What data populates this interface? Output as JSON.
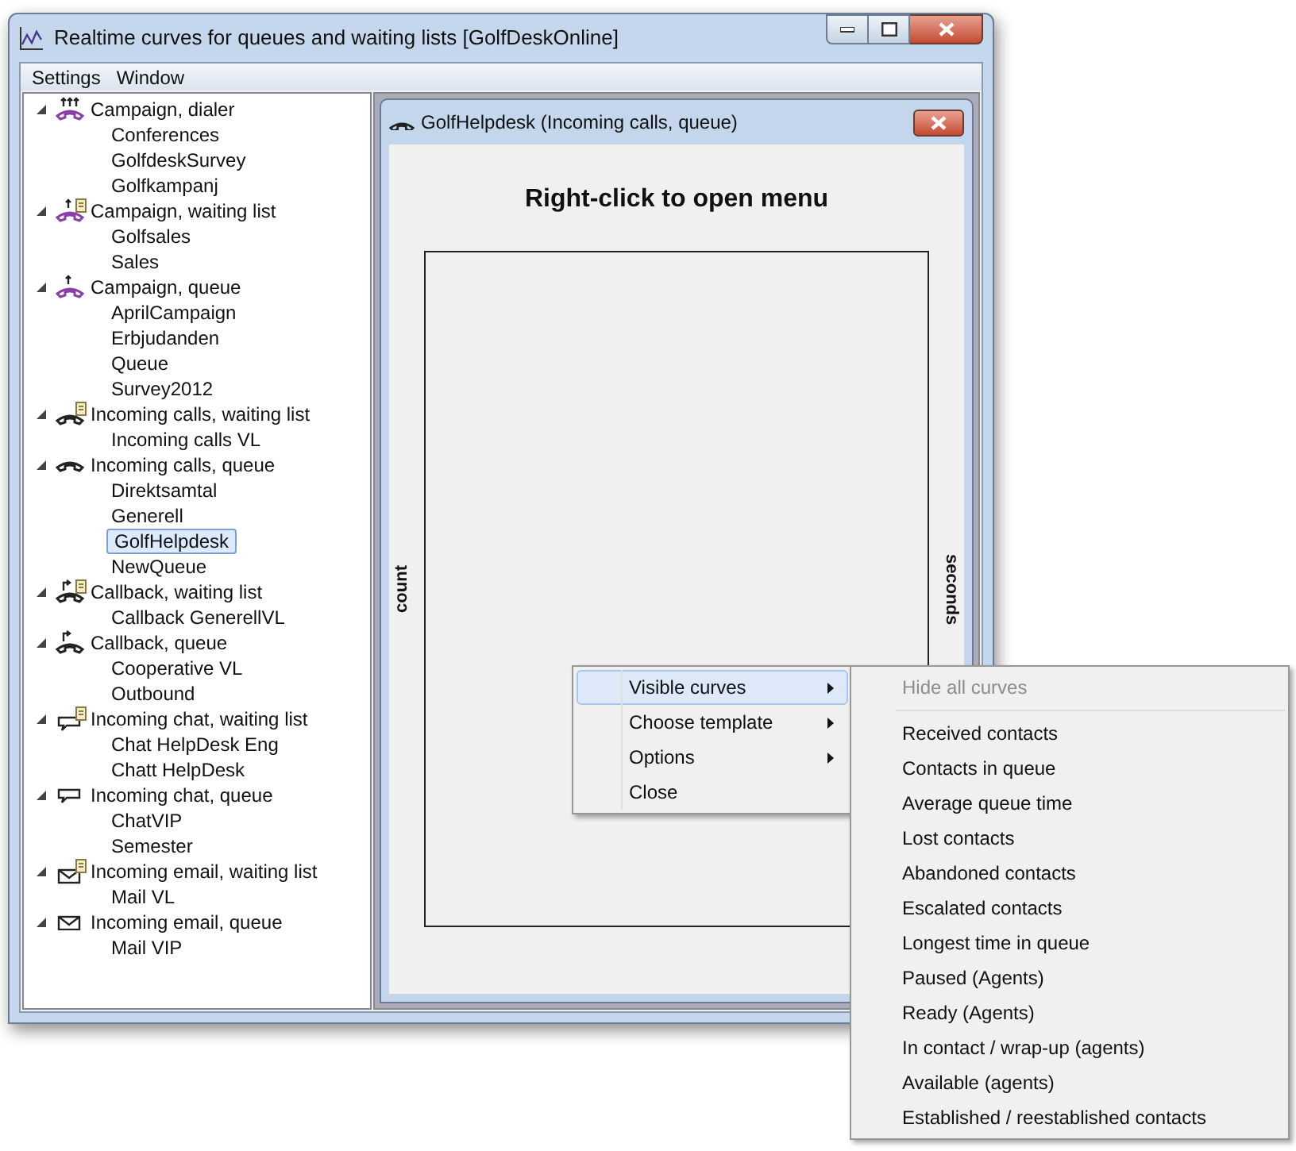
{
  "window": {
    "title": "Realtime curves for queues and waiting lists [GolfDeskOnline]"
  },
  "menu_bar": [
    "Settings",
    "Window"
  ],
  "tree": [
    {
      "label": "Campaign, dialer",
      "kind": "campaign-dialer",
      "expanded": true,
      "children": [
        {
          "label": "Conferences",
          "selected": false
        },
        {
          "label": "GolfdeskSurvey",
          "selected": false
        },
        {
          "label": "Golfkampanj",
          "selected": false
        }
      ]
    },
    {
      "label": "Campaign, waiting list",
      "kind": "campaign-list",
      "expanded": true,
      "children": [
        {
          "label": "Golfsales",
          "selected": false
        },
        {
          "label": "Sales",
          "selected": false
        }
      ]
    },
    {
      "label": "Campaign, queue",
      "kind": "campaign-queue",
      "expanded": true,
      "children": [
        {
          "label": "AprilCampaign",
          "selected": false
        },
        {
          "label": "Erbjudanden",
          "selected": false
        },
        {
          "label": "Queue",
          "selected": false
        },
        {
          "label": "Survey2012",
          "selected": false
        }
      ]
    },
    {
      "label": "Incoming calls, waiting list",
      "kind": "calls-list",
      "expanded": true,
      "children": [
        {
          "label": "Incoming calls VL",
          "selected": false
        }
      ]
    },
    {
      "label": "Incoming calls, queue",
      "kind": "calls-queue",
      "expanded": true,
      "children": [
        {
          "label": "Direktsamtal",
          "selected": false
        },
        {
          "label": "Generell",
          "selected": false
        },
        {
          "label": "GolfHelpdesk",
          "selected": true
        },
        {
          "label": "NewQueue",
          "selected": false
        }
      ]
    },
    {
      "label": "Callback, waiting list",
      "kind": "callback-list",
      "expanded": true,
      "children": [
        {
          "label": "Callback GenerellVL",
          "selected": false
        }
      ]
    },
    {
      "label": "Callback, queue",
      "kind": "callback-queue",
      "expanded": true,
      "children": [
        {
          "label": "Cooperative VL",
          "selected": false
        },
        {
          "label": "Outbound",
          "selected": false
        }
      ]
    },
    {
      "label": "Incoming chat, waiting list",
      "kind": "chat-list",
      "expanded": true,
      "children": [
        {
          "label": "Chat  HelpDesk Eng",
          "selected": false
        },
        {
          "label": "Chatt HelpDesk",
          "selected": false
        }
      ]
    },
    {
      "label": "Incoming chat, queue",
      "kind": "chat-queue",
      "expanded": true,
      "children": [
        {
          "label": "ChatVIP",
          "selected": false
        },
        {
          "label": "Semester",
          "selected": false
        }
      ]
    },
    {
      "label": "Incoming email, waiting list",
      "kind": "email-list",
      "expanded": true,
      "children": [
        {
          "label": "Mail VL",
          "selected": false
        }
      ]
    },
    {
      "label": "Incoming email, queue",
      "kind": "email-queue",
      "expanded": true,
      "children": [
        {
          "label": "Mail VIP",
          "selected": false
        }
      ]
    }
  ],
  "child_window": {
    "title": "GolfHelpdesk (Incoming calls, queue)",
    "heading": "Right-click to open menu",
    "left_axis": "count",
    "right_axis": "seconds"
  },
  "context_menu": [
    {
      "label": "Visible curves",
      "submenu": true,
      "selected": true
    },
    {
      "label": "Choose template",
      "submenu": true,
      "selected": false
    },
    {
      "label": "Options",
      "submenu": true,
      "selected": false
    },
    {
      "label": "Close",
      "submenu": false,
      "selected": false
    }
  ],
  "submenu": [
    {
      "label": "Hide all curves",
      "disabled": true,
      "separator_after": true
    },
    {
      "label": "Received contacts",
      "disabled": false,
      "separator_after": false
    },
    {
      "label": "Contacts in queue",
      "disabled": false,
      "separator_after": false
    },
    {
      "label": "Average queue time",
      "disabled": false,
      "separator_after": false
    },
    {
      "label": "Lost contacts",
      "disabled": false,
      "separator_after": false
    },
    {
      "label": "Abandoned contacts",
      "disabled": false,
      "separator_after": false
    },
    {
      "label": "Escalated contacts",
      "disabled": false,
      "separator_after": false
    },
    {
      "label": "Longest time in queue",
      "disabled": false,
      "separator_after": false
    },
    {
      "label": "Paused (Agents)",
      "disabled": false,
      "separator_after": false
    },
    {
      "label": "Ready (Agents)",
      "disabled": false,
      "separator_after": false
    },
    {
      "label": "In contact / wrap-up (agents)",
      "disabled": false,
      "separator_after": false
    },
    {
      "label": "Available (agents)",
      "disabled": false,
      "separator_after": false
    },
    {
      "label": "Established / reestablished contacts",
      "disabled": false,
      "separator_after": false
    }
  ]
}
